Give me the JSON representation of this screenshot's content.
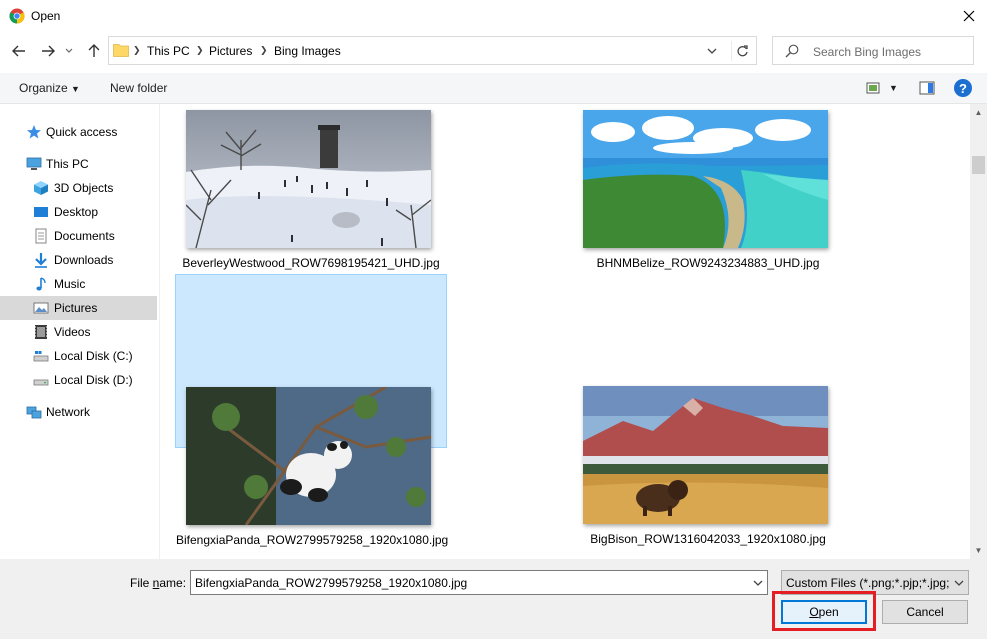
{
  "window": {
    "title": "Open"
  },
  "navigation": {
    "breadcrumbs": [
      "This PC",
      "Pictures",
      "Bing Images"
    ],
    "search_placeholder": "Search Bing Images"
  },
  "toolbar": {
    "organize_label": "Organize",
    "new_folder_label": "New folder",
    "help_label": "?"
  },
  "sidebar": {
    "items": [
      {
        "label": "Quick access",
        "icon": "star-icon"
      },
      {
        "label": "This PC",
        "icon": "computer-icon"
      },
      {
        "label": "3D Objects",
        "icon": "cube-icon"
      },
      {
        "label": "Desktop",
        "icon": "desktop-icon"
      },
      {
        "label": "Documents",
        "icon": "document-icon"
      },
      {
        "label": "Downloads",
        "icon": "download-icon"
      },
      {
        "label": "Music",
        "icon": "music-icon"
      },
      {
        "label": "Pictures",
        "icon": "pictures-icon",
        "selected": true
      },
      {
        "label": "Videos",
        "icon": "video-icon"
      },
      {
        "label": "Local Disk (C:)",
        "icon": "drive-icon"
      },
      {
        "label": "Local Disk (D:)",
        "icon": "drive-icon"
      },
      {
        "label": "Network",
        "icon": "network-icon"
      }
    ]
  },
  "files": [
    {
      "name": "BeverleyWestwood_ROW7698195421_UHD.jpg",
      "thumbnail": "snowy-hill-tower"
    },
    {
      "name": "BHNMBelize_ROW9243234883_UHD.jpg",
      "thumbnail": "aerial-coast-lagoon"
    },
    {
      "name": "BifengxiaPanda_ROW2799579258_1920x1080.jpg",
      "thumbnail": "panda-in-tree",
      "selected": true
    },
    {
      "name": "BigBison_ROW1316042033_1920x1080.jpg",
      "thumbnail": "bison-mountains"
    }
  ],
  "footer": {
    "file_name_label_pre": "File ",
    "file_name_label_u": "n",
    "file_name_label_post": "ame:",
    "file_name_value": "BifengxiaPanda_ROW2799579258_1920x1080.jpg",
    "file_type_value": "Custom Files (*.png;*.pjp;*.jpg;",
    "open_label_u": "O",
    "open_label_rest": "pen",
    "cancel_label": "Cancel"
  },
  "colors": {
    "selection": "#cce8ff",
    "accent": "#0078d7",
    "highlight": "#e31e24"
  }
}
